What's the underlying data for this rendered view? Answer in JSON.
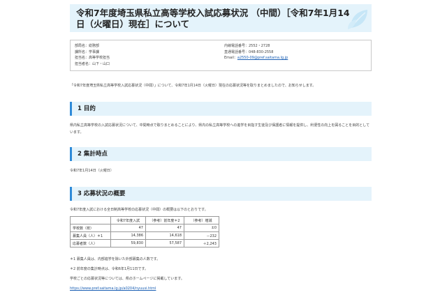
{
  "header": {
    "title": "令和7年度埼玉県私立高等学校入試応募状況 （中間）［令和7年1月14日（火曜日）現在］について"
  },
  "info": {
    "left": [
      "部局名：総務部",
      "課所名：学事課",
      "担当名：高等学校担当",
      "担当者名：山下・山口"
    ],
    "right_phone": "内線電話番号：2552・2728",
    "right_direct": "直通電話番号：048-830-2558",
    "email_label": "Email：",
    "email": "a2550-09@pref.saitama.lg.jp"
  },
  "intro": "「令和7年度埼玉県私立高等学校入試応募状況（中間）」について、令和7年1月14日（火曜日）現在の応募状況等を取りまとめましたので、お知らせします。",
  "sections": {
    "s1": {
      "heading": "1 目的",
      "body": "県内私立高等学校の入試応募状況について、中間時点で取りまとめることにより、県内の私立高等学校への進学を目指す生徒及び保護者に情報を提供し、利便性の向上を図ることを目的としています。"
    },
    "s2": {
      "heading": "2 集計時点",
      "body": "令和7年1月14日（火曜日）"
    },
    "s3": {
      "heading": "3 応募状況の概要",
      "body": "令和7年度入試における全日制高等学校の応募状況（中間）の概要は以下のとおりです。"
    }
  },
  "table": {
    "headers": [
      "",
      "令和7年度入試",
      "（参考）前年度＊2",
      "（参考）増減"
    ],
    "rows": [
      [
        "学校数（校）",
        "47",
        "47",
        "±0"
      ],
      [
        "募集人員（人）＊1",
        "14,386",
        "14,618",
        "－232"
      ],
      [
        "応募者数（人）",
        "59,830",
        "57,587",
        "＋2,243"
      ]
    ]
  },
  "notes": {
    "n1": "＊1 募集人員は、内部進学を除いた外部募集の人数です。",
    "n2": "＊2 前年度の集計時点は、令和6年1月11日です。",
    "n3": "学校ごとの応募状況等については、県のホームページに掲載しています。",
    "url": "https://www.pref.saitama.lg.jp/a0204/nyuusi.html"
  }
}
